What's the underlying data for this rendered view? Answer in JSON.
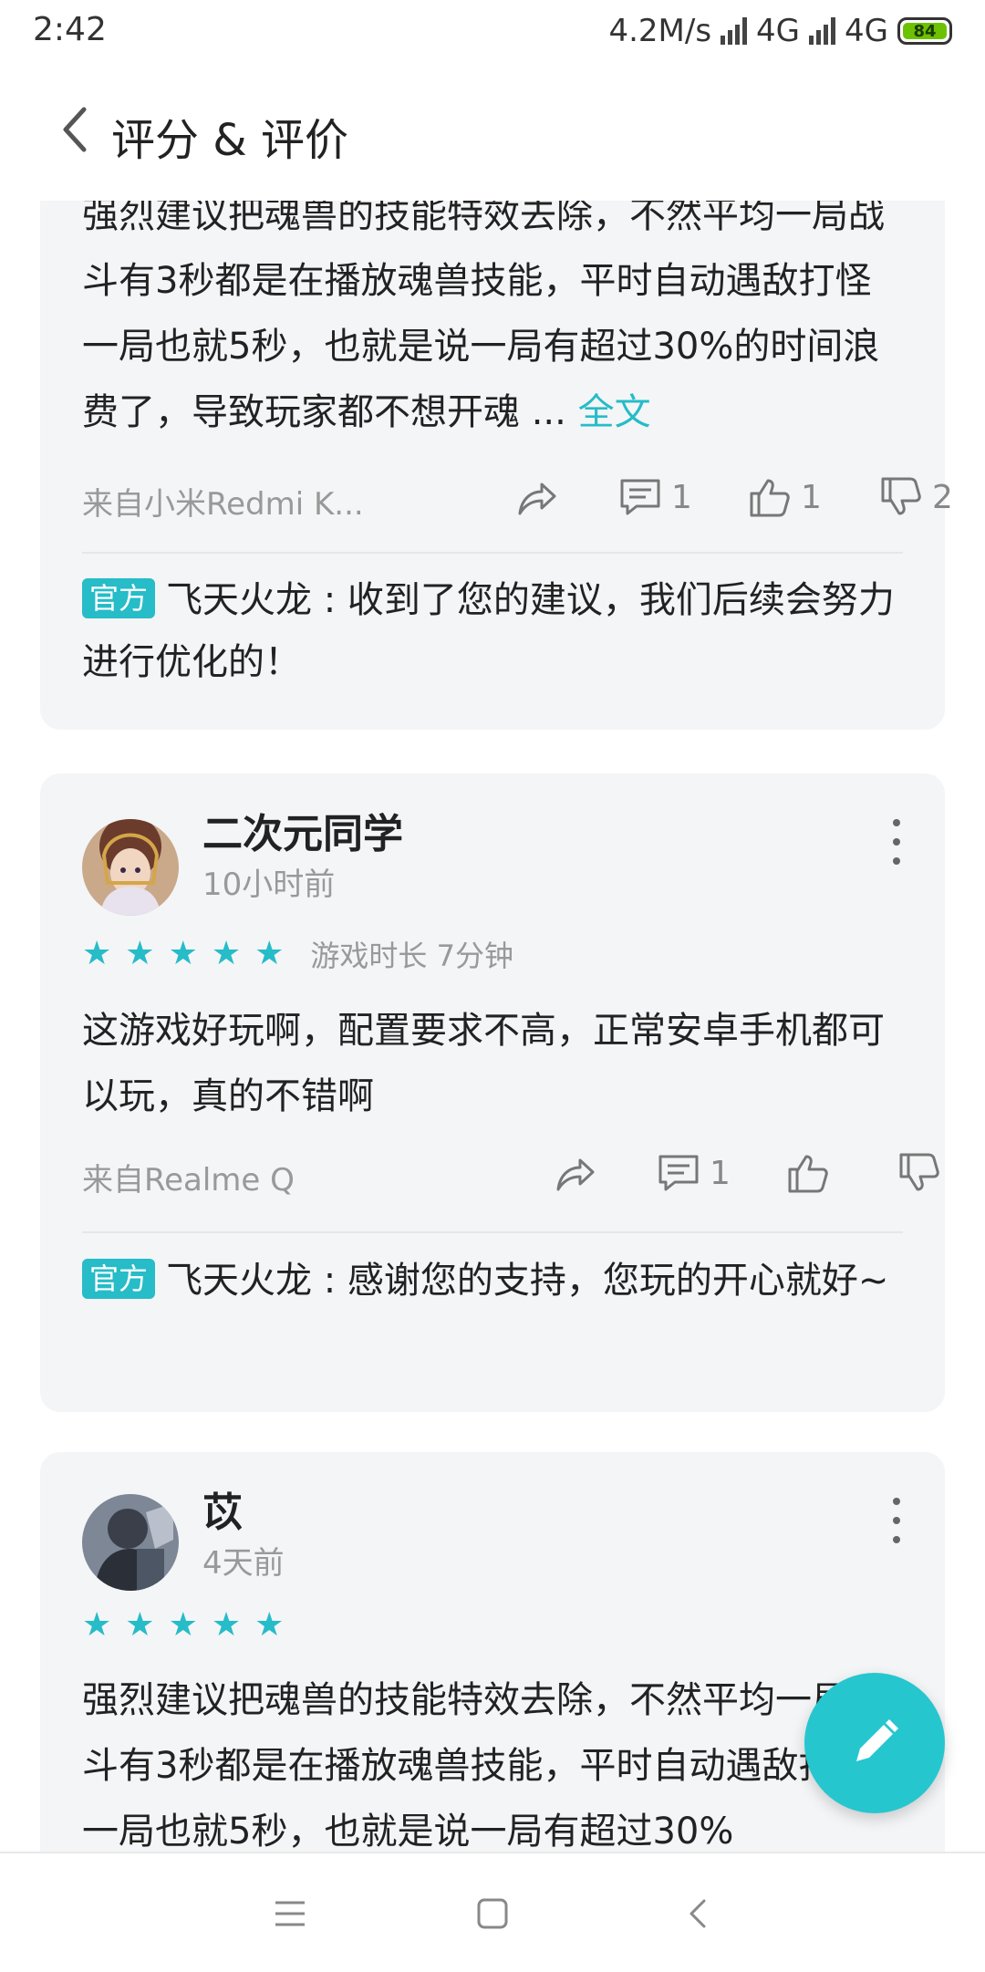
{
  "status": {
    "time": "2:42",
    "speed": "4.2M/s",
    "net1": "4G",
    "net2": "4G",
    "battery": "84"
  },
  "header": {
    "title": "评分 & 评价"
  },
  "reviews": [
    {
      "text": "强烈建议把魂兽的技能特效去除，不然平均一局战斗有3秒都是在播放魂兽技能，平时自动遇敌打怪一局也就5秒，也就是说一局有超过30%的时间浪费了，导致玩家都不想开魂 ... ",
      "more": "全文",
      "device": "来自小米Redmi K...",
      "comments": "1",
      "likes": "1",
      "dislikes": "2",
      "reply": {
        "badge": "官方",
        "text": "飞天火龙 : 收到了您的建议，我们后续会努力进行优化的！"
      }
    },
    {
      "user": "二次元同学",
      "time": "10小时前",
      "rating": 5,
      "playtime": "游戏时长 7分钟",
      "text": "这游戏好玩啊，配置要求不高，正常安卓手机都可以玩，真的不错啊",
      "device": "来自Realme Q",
      "comments": "1",
      "reply": {
        "badge": "官方",
        "text": "飞天火龙 : 感谢您的支持，您玩的开心就好~"
      }
    },
    {
      "user": "苡",
      "time": "4天前",
      "rating": 5,
      "text": "强烈建议把魂兽的技能特效去除，不然平均一局战斗有3秒都是在播放魂兽技能，平时自动遇敌打怪一局也就5秒，也就是说一局有超过30%"
    }
  ],
  "colors": {
    "accent": "#26bcc8",
    "card": "#f4f5f7"
  },
  "icons": {
    "share": "share-icon",
    "comment": "comment-icon",
    "like": "thumbs-up-icon",
    "dislike": "thumbs-down-icon",
    "more": "more-vertical-icon",
    "fab": "pencil-icon"
  }
}
